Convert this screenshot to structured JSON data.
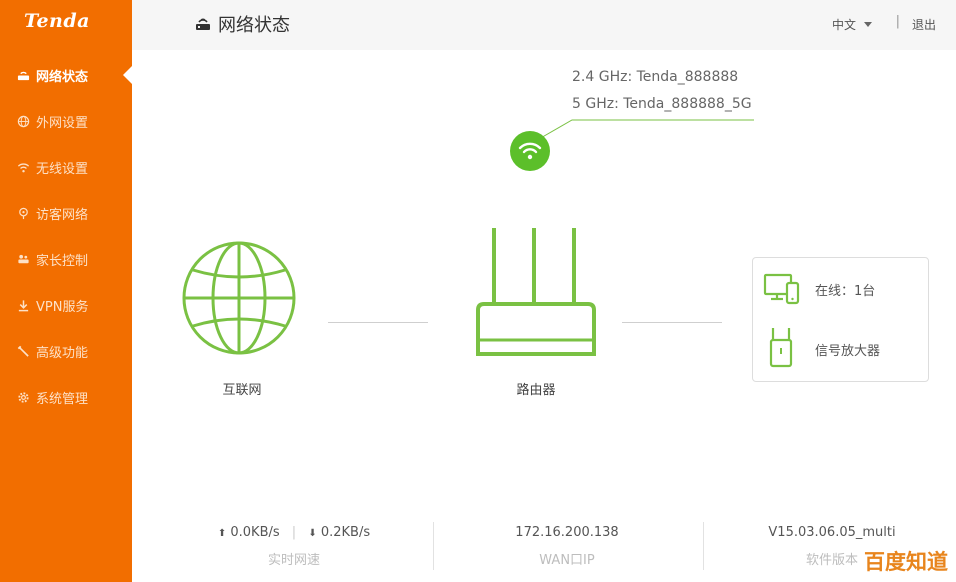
{
  "brand": {
    "logo_text": "Tenda"
  },
  "header": {
    "title": "网络状态",
    "lang": "中文",
    "separator": "|",
    "logout": "退出"
  },
  "sidebar": {
    "items": [
      {
        "label": "网络状态",
        "icon": "router-icon"
      },
      {
        "label": "外网设置",
        "icon": "globe-icon"
      },
      {
        "label": "无线设置",
        "icon": "wifi-icon"
      },
      {
        "label": "访客网络",
        "icon": "guest-icon"
      },
      {
        "label": "家长控制",
        "icon": "parental-icon"
      },
      {
        "label": "VPN服务",
        "icon": "download-icon"
      },
      {
        "label": "高级功能",
        "icon": "wrench-icon"
      },
      {
        "label": "系统管理",
        "icon": "gear-icon"
      }
    ]
  },
  "wifi": {
    "ssid_24": "2.4 GHz: Tenda_888888",
    "ssid_5": "5 GHz: Tenda_888888_5G"
  },
  "diagram": {
    "internet_label": "互联网",
    "router_label": "路由器"
  },
  "clients": {
    "online": "在线：1台",
    "extender": "信号放大器"
  },
  "stats": {
    "up_arrow": "⬆",
    "up": "0.0KB/s",
    "down_arrow": "⬇",
    "down": "0.2KB/s",
    "speed_label": "实时网速",
    "wan_ip": "172.16.200.138",
    "wan_label": "WAN口IP",
    "version": "V15.03.06.05_multi",
    "version_label": "软件版本"
  },
  "watermark": "百度知道",
  "colors": {
    "sidebar": "#f26e00",
    "accent_green": "#7ac143",
    "wifi_green": "#5cbf2a"
  }
}
